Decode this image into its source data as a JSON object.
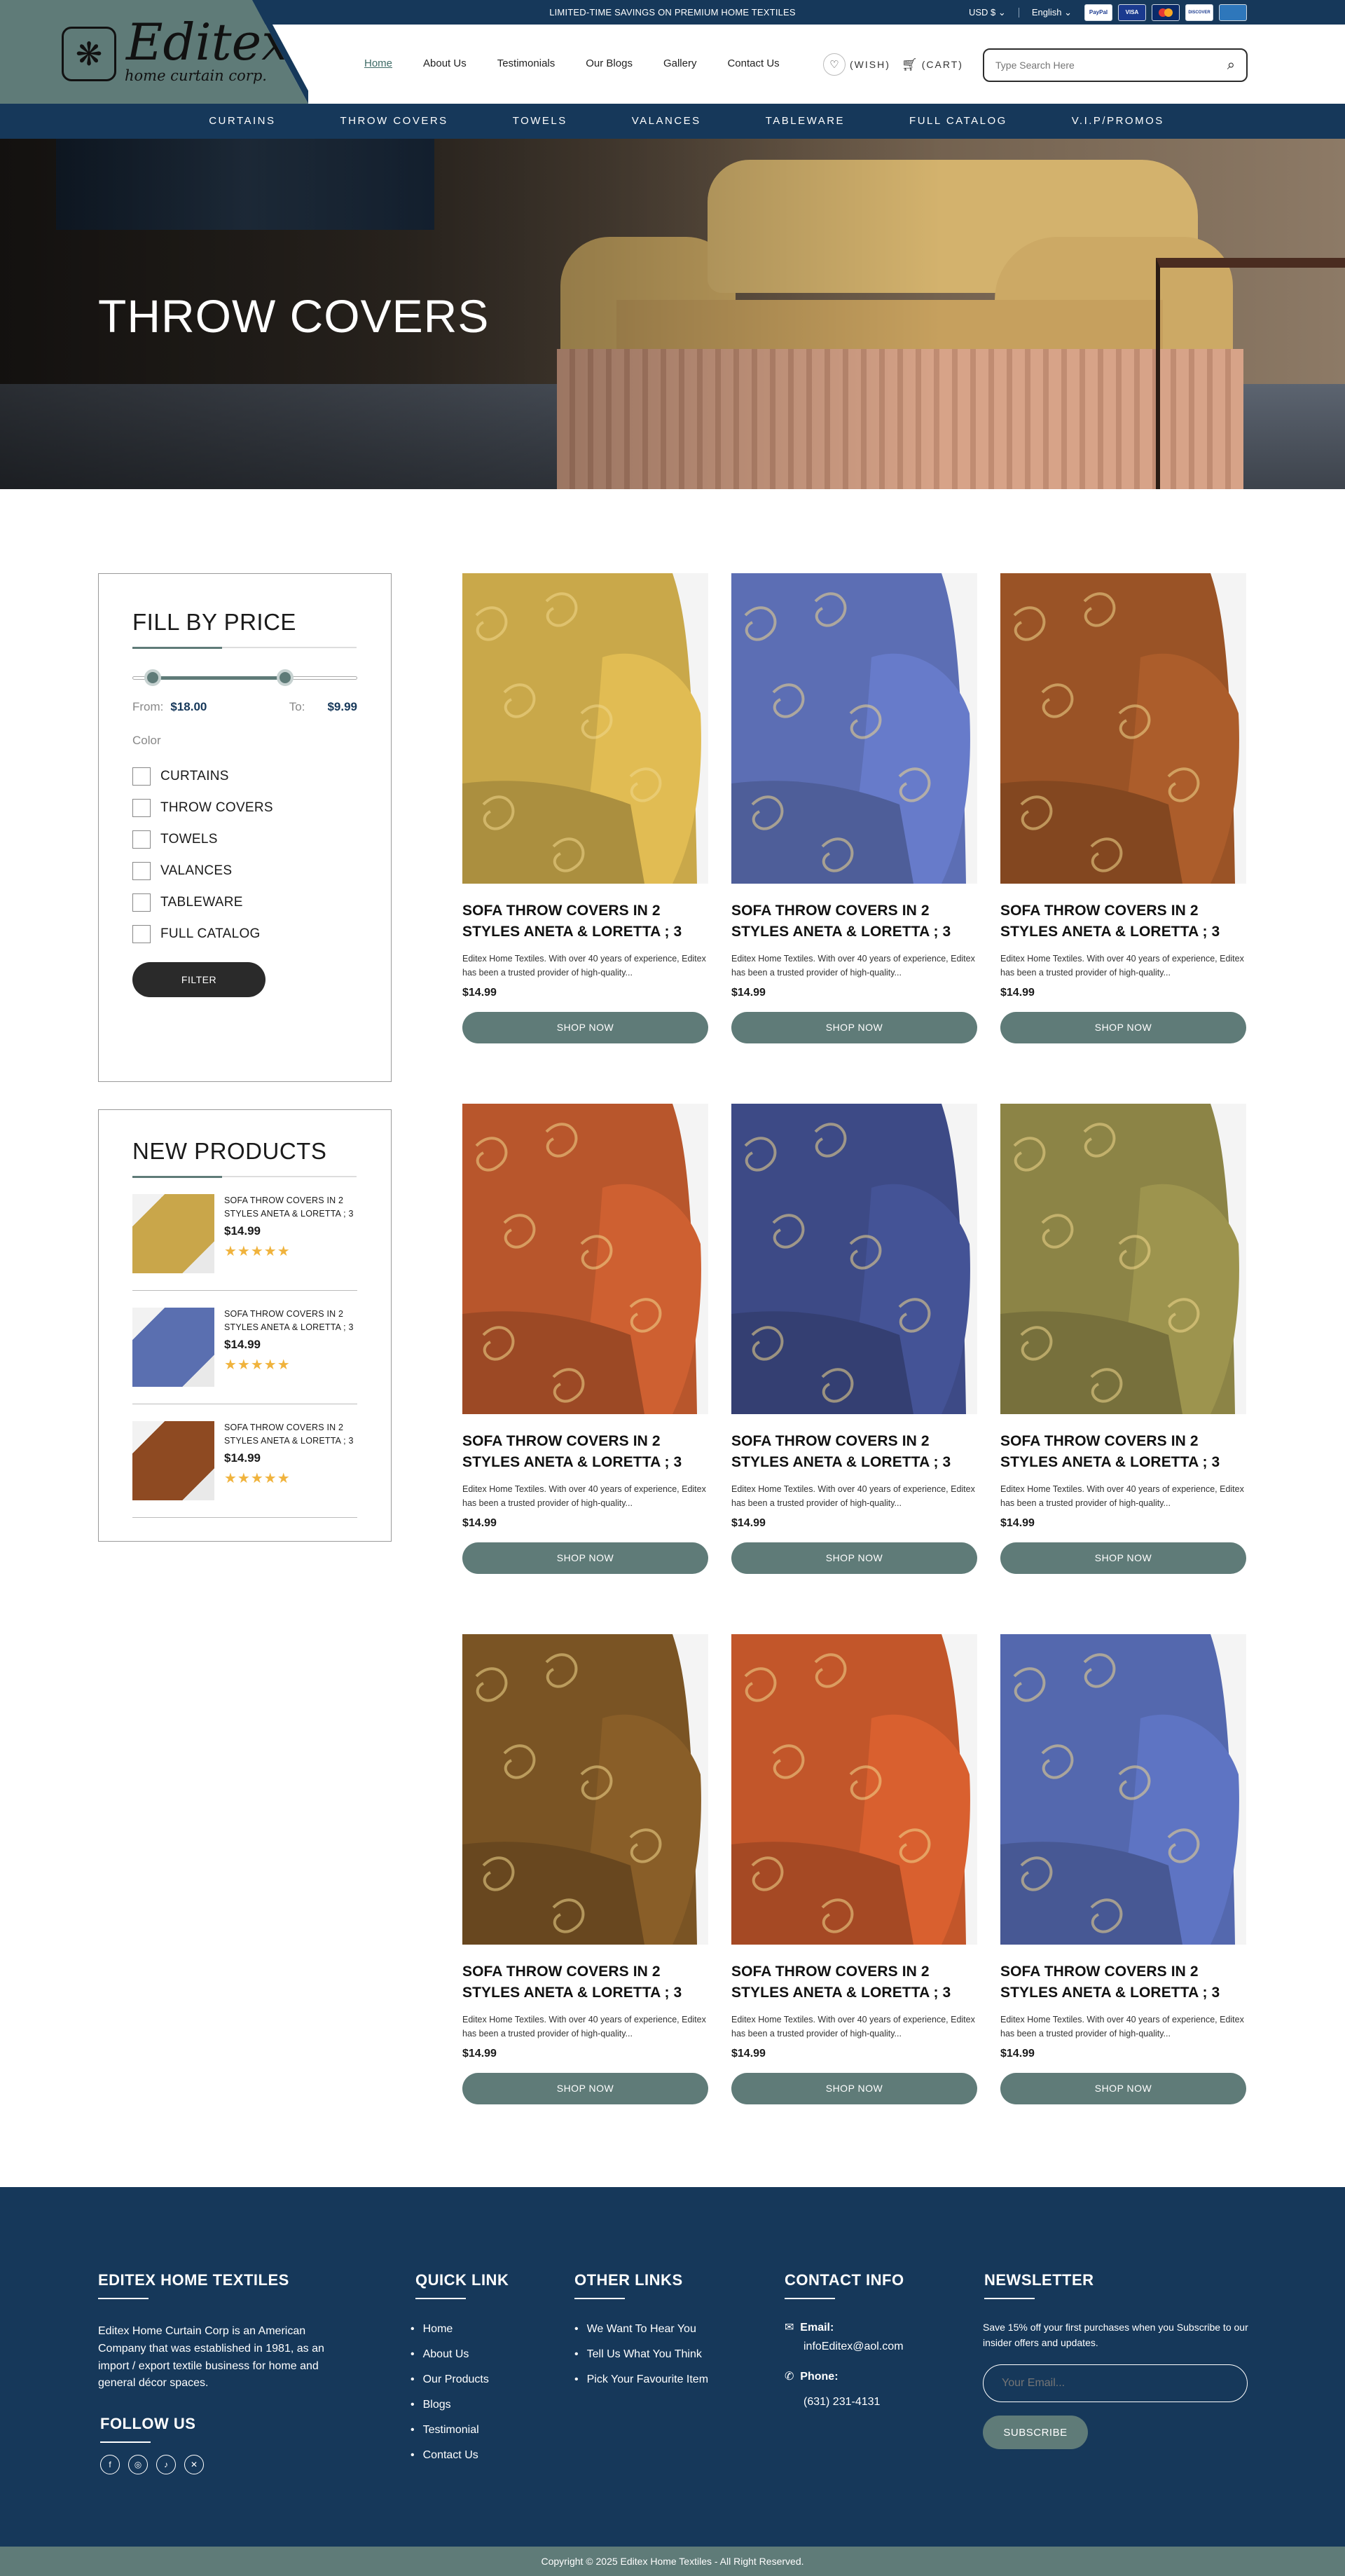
{
  "topbar": {
    "promo": "LIMITED-TIME SAVINGS ON PREMIUM HOME TEXTILES",
    "currency": "USD $",
    "language": "English",
    "payments": [
      "PayPal",
      "VISA",
      "Mastercard",
      "DISCOVER",
      "AMEX"
    ]
  },
  "logo": {
    "name": "Editex",
    "tagline": "home curtain corp.",
    "mark": "❋"
  },
  "nav": [
    "Home",
    "About Us",
    "Testimonials",
    "Our Blogs",
    "Gallery",
    "Contact Us"
  ],
  "utils": {
    "wish": "(WISH)",
    "cart": "(CART)"
  },
  "search": {
    "placeholder": "Type Search Here"
  },
  "categories": [
    "CURTAINS",
    "THROW COVERS",
    "TOWELS",
    "VALANCES",
    "TABLEWARE",
    "FULL CATALOG",
    "V.I.P/PROMOS"
  ],
  "hero": {
    "title": "THROW COVERS"
  },
  "filter": {
    "title": "FILL BY PRICE",
    "price_range": {
      "min_fraction": 0.09,
      "max_fraction": 0.68
    },
    "from_label": "From:",
    "from_value": "$18.00",
    "to_label": "To:",
    "to_value": "$9.99",
    "color_label": "Color",
    "options": [
      "CURTAINS",
      "THROW COVERS",
      "TOWELS",
      "VALANCES",
      "TABLEWARE",
      "FULL CATALOG"
    ],
    "button": "FILTER"
  },
  "new_products": {
    "title": "NEW PRODUCTS",
    "items": [
      {
        "title": "SOFA THROW COVERS IN 2 STYLES ANETA & LORETTA ; 3",
        "price": "$14.99",
        "rating": 5,
        "color": "#c9a64a"
      },
      {
        "title": "SOFA THROW COVERS IN 2 STYLES ANETA & LORETTA ; 3",
        "price": "$14.99",
        "rating": 5,
        "color": "#5a6fb0"
      },
      {
        "title": "SOFA THROW COVERS IN 2 STYLES ANETA & LORETTA ; 3",
        "price": "$14.99",
        "rating": 5,
        "color": "#8e4a22"
      }
    ]
  },
  "products": [
    {
      "title": "SOFA THROW COVERS IN 2 STYLES ANETA & LORETTA ; 3",
      "desc": "Editex Home Textiles. With over 40 years of experience, Editex has been a trusted provider of high-quality...",
      "price": "$14.99",
      "button": "SHOP NOW",
      "color": "#c9a84a"
    },
    {
      "title": "SOFA THROW COVERS IN 2 STYLES ANETA & LORETTA ; 3",
      "desc": "Editex Home Textiles. With over 40 years of experience, Editex has been a trusted provider of high-quality...",
      "price": "$14.99",
      "button": "SHOP NOW",
      "color": "#5c6eb4"
    },
    {
      "title": "SOFA THROW COVERS IN 2 STYLES ANETA & LORETTA ; 3",
      "desc": "Editex Home Textiles. With over 40 years of experience, Editex has been a trusted provider of high-quality...",
      "price": "$14.99",
      "button": "SHOP NOW",
      "color": "#9a5326"
    },
    {
      "title": "SOFA THROW COVERS IN 2 STYLES ANETA & LORETTA ; 3",
      "desc": "Editex Home Textiles. With over 40 years of experience, Editex has been a trusted provider of high-quality...",
      "price": "$14.99",
      "button": "SHOP NOW",
      "color": "#b8562c"
    },
    {
      "title": "SOFA THROW COVERS IN 2 STYLES ANETA & LORETTA ; 3",
      "desc": "Editex Home Textiles. With over 40 years of experience, Editex has been a trusted provider of high-quality...",
      "price": "$14.99",
      "button": "SHOP NOW",
      "color": "#3d4a86"
    },
    {
      "title": "SOFA THROW COVERS IN 2 STYLES ANETA & LORETTA ; 3",
      "desc": "Editex Home Textiles. With over 40 years of experience, Editex has been a trusted provider of high-quality...",
      "price": "$14.99",
      "button": "SHOP NOW",
      "color": "#8c8446"
    },
    {
      "title": "SOFA THROW COVERS IN 2 STYLES ANETA & LORETTA ; 3",
      "desc": "Editex Home Textiles. With over 40 years of experience, Editex has been a trusted provider of high-quality...",
      "price": "$14.99",
      "button": "SHOP NOW",
      "color": "#7a5424"
    },
    {
      "title": "SOFA THROW COVERS IN 2 STYLES ANETA & LORETTA ; 3",
      "desc": "Editex Home Textiles. With over 40 years of experience, Editex has been a trusted provider of high-quality...",
      "price": "$14.99",
      "button": "SHOP NOW",
      "color": "#c2562a"
    },
    {
      "title": "SOFA THROW COVERS IN 2 STYLES ANETA & LORETTA ; 3",
      "desc": "Editex Home Textiles. With over 40 years of experience, Editex has been a trusted provider of high-quality...",
      "price": "$14.99",
      "button": "SHOP NOW",
      "color": "#5468ae"
    }
  ],
  "footer": {
    "brand_title": "EDITEX HOME TEXTILES",
    "about": "Editex Home Curtain Corp is an American Company that was established in 1981, as an import / export textile business for home and general décor spaces.",
    "follow_title": "FOLLOW US",
    "social": [
      "f",
      "◎",
      "♪",
      "✕"
    ],
    "quick_title": "QUICK LINK",
    "quick_links": [
      "Home",
      "About Us",
      "Our Products",
      "Blogs",
      "Testimonial",
      "Contact Us"
    ],
    "other_title": "OTHER LINKS",
    "other_links": [
      "We Want To Hear You",
      "Tell Us What You Think",
      "Pick Your Favourite Item"
    ],
    "contact_title": "CONTACT INFO",
    "email_label": "Email:",
    "email": "infoEditex@aol.com",
    "phone_label": "Phone:",
    "phone": "(631) 231-4131",
    "newsletter_title": "NEWSLETTER",
    "newsletter_text": "Save 15% off your first purchases when you Subscribe to our insider offers and updates.",
    "newsletter_placeholder": "Your Email...",
    "subscribe": "SUBSCRIBE",
    "copyright": "Copyright © 2025 Editex Home Textiles - All Right Reserved."
  }
}
